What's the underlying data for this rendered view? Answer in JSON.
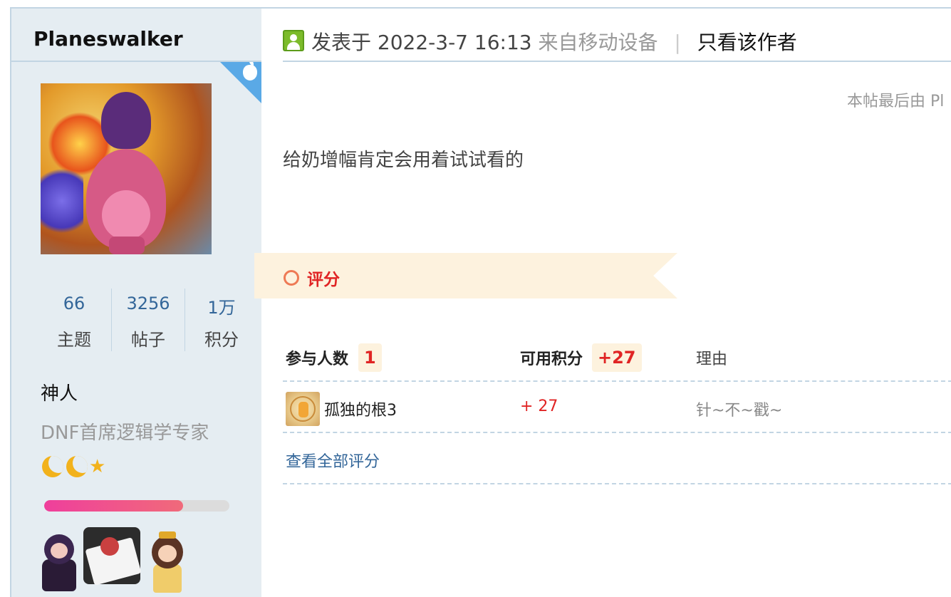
{
  "author": {
    "username": "Planeswalker",
    "device_badge": "apple-icon",
    "stats": [
      {
        "value": "66",
        "label": "主题"
      },
      {
        "value": "3256",
        "label": "帖子"
      },
      {
        "value": "1万",
        "label": "积分"
      }
    ],
    "rank_title": "神人",
    "custom_title": "DNF首席逻辑学专家",
    "level_icons": [
      "moon-icon",
      "moon-icon",
      "star-icon"
    ],
    "level_progress": 0.75
  },
  "post": {
    "posted_prefix": "发表于 2022-3-7 16:13",
    "device": "来自移动设备",
    "separator": "|",
    "only_author": "只看该作者",
    "edited_note": "本帖最后由 Pl",
    "content": "给奶增幅肯定会用着试试看的"
  },
  "rating": {
    "title": "评分",
    "participants_label": "参与人数",
    "participants_count": "1",
    "score_label": "可用积分",
    "score_total": "+27",
    "reason_label": "理由",
    "entries": [
      {
        "user": "孤独的根3",
        "score": "+ 27",
        "reason": "针~不~戳~"
      }
    ],
    "view_all": "查看全部评分"
  },
  "colors": {
    "sidebar_bg": "#e5edf2",
    "border": "#c2d5e3",
    "accent_red": "#e02424",
    "link_blue": "#336699",
    "banner_bg": "#fdf2de",
    "progress_fill": "#ef3f9c"
  }
}
